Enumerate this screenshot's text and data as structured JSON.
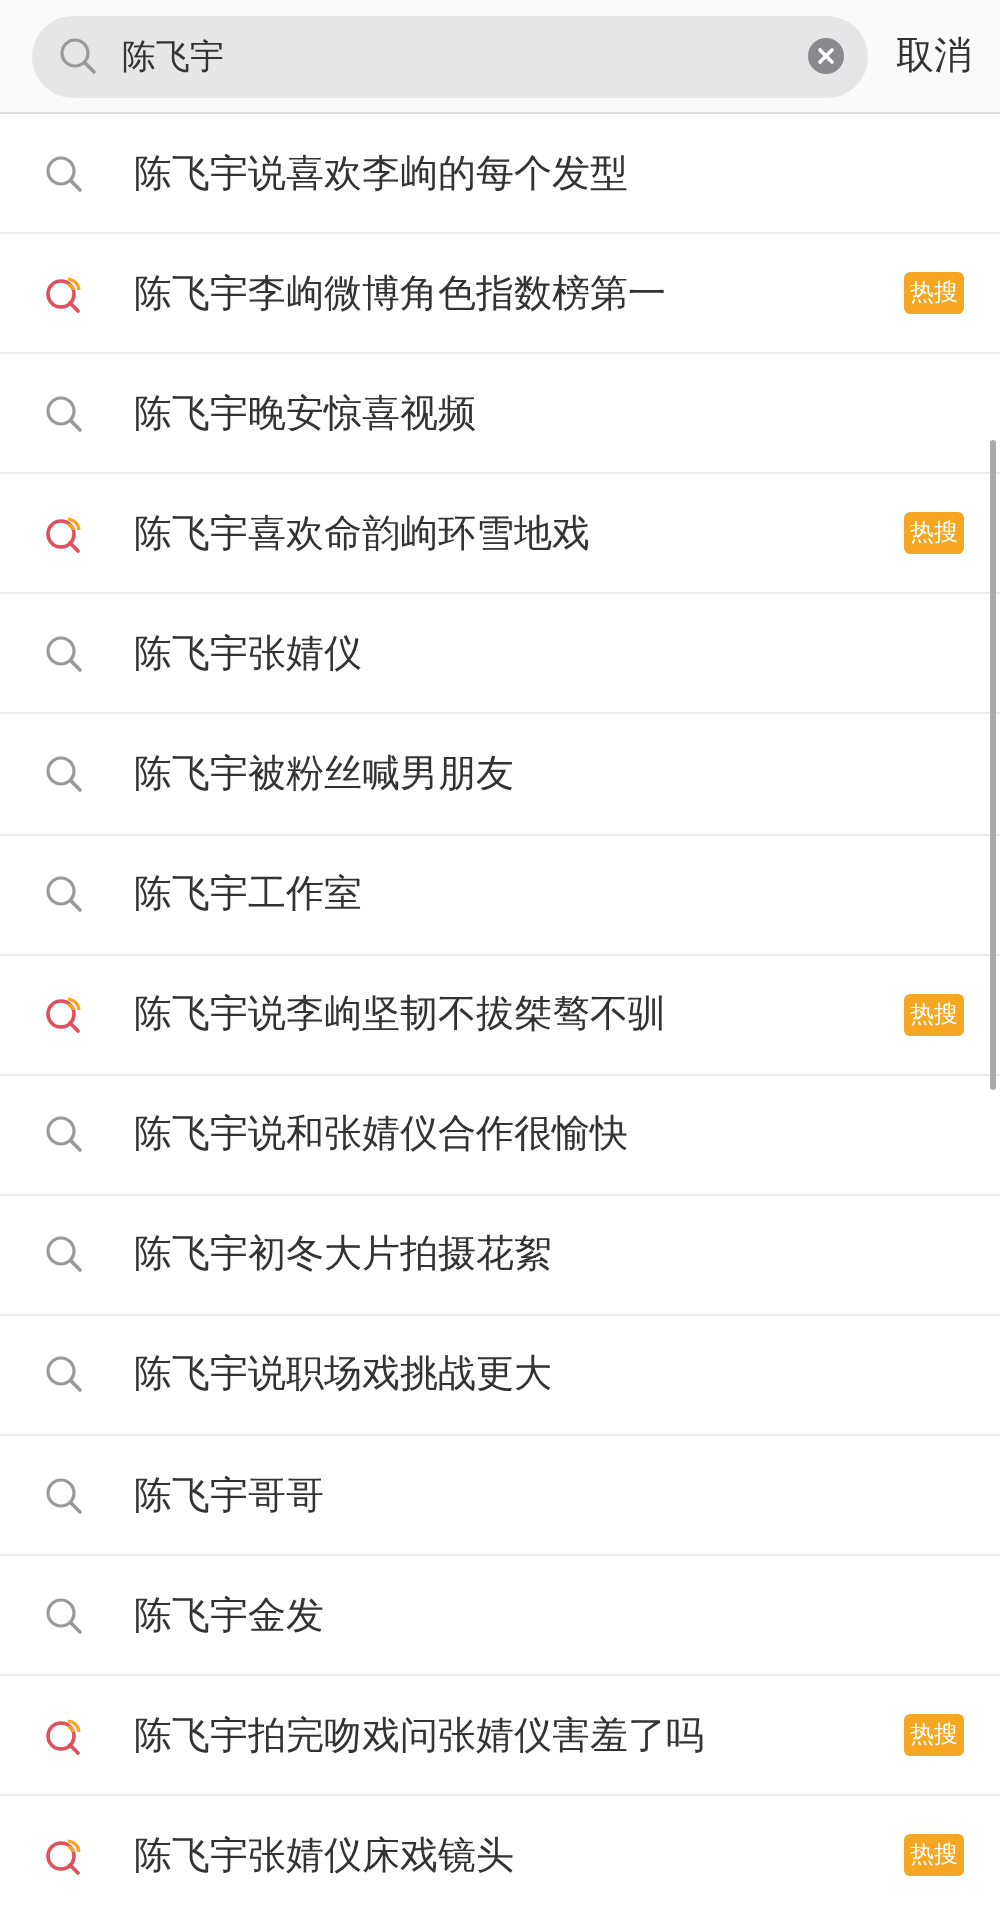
{
  "search": {
    "value": "陈飞宇",
    "cancel": "取消"
  },
  "suggestions": [
    {
      "kind": "plain",
      "text": "陈飞宇说喜欢李岣的每个发型"
    },
    {
      "kind": "hot",
      "text": "陈飞宇李岣微博角色指数榜第一",
      "badge": "热搜"
    },
    {
      "kind": "plain",
      "text": "陈飞宇晚安惊喜视频"
    },
    {
      "kind": "hot",
      "text": "陈飞宇喜欢命韵岣环雪地戏",
      "badge": "热搜"
    },
    {
      "kind": "plain",
      "text": "陈飞宇张婧仪"
    },
    {
      "kind": "plain",
      "text": "陈飞宇被粉丝喊男朋友"
    },
    {
      "kind": "plain",
      "text": "陈飞宇工作室"
    },
    {
      "kind": "hot",
      "text": "陈飞宇说李岣坚韧不拔桀骜不驯",
      "badge": "热搜"
    },
    {
      "kind": "plain",
      "text": "陈飞宇说和张婧仪合作很愉快"
    },
    {
      "kind": "plain",
      "text": "陈飞宇初冬大片拍摄花絮"
    },
    {
      "kind": "plain",
      "text": "陈飞宇说职场戏挑战更大"
    },
    {
      "kind": "plain",
      "text": "陈飞宇哥哥"
    },
    {
      "kind": "plain",
      "text": "陈飞宇金发"
    },
    {
      "kind": "hot",
      "text": "陈飞宇拍完吻戏问张婧仪害羞了吗",
      "badge": "热搜"
    },
    {
      "kind": "hot",
      "text": "陈飞宇张婧仪床戏镜头",
      "badge": "热搜"
    }
  ]
}
